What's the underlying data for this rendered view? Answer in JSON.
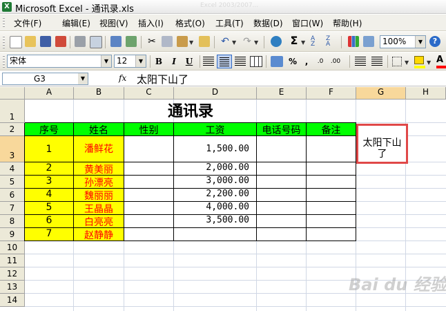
{
  "window": {
    "title": "Microsoft Excel - 通讯录.xls",
    "app_icon": "excel-icon",
    "ghost_text": "Excel 2003/2007..."
  },
  "menu": [
    "文件(F)",
    "编辑(E)",
    "视图(V)",
    "插入(I)",
    "格式(O)",
    "工具(T)",
    "数据(D)",
    "窗口(W)",
    "帮助(H)"
  ],
  "standard_toolbar": {
    "zoom": "100%"
  },
  "format_toolbar": {
    "font_name": "宋体",
    "font_size": "12",
    "bold": "B",
    "italic": "I",
    "underline": "U",
    "percent": "%",
    "comma": ",",
    "inc_dec": ".0",
    "dec_dec": ".00"
  },
  "formula_bar": {
    "name_box": "G3",
    "fx": "fx",
    "content": "太阳下山了"
  },
  "columns": [
    "A",
    "B",
    "C",
    "D",
    "E",
    "F",
    "G",
    "H"
  ],
  "rows": [
    "1",
    "2",
    "3",
    "4",
    "5",
    "6",
    "7",
    "8",
    "9",
    "10",
    "11",
    "12",
    "13",
    "14"
  ],
  "sheet": {
    "title": "通讯录",
    "headers": [
      "序号",
      "姓名",
      "性别",
      "工资",
      "电话号码",
      "备注"
    ],
    "records": [
      {
        "no": "1",
        "name": "潘鲜花",
        "salary": "1,500.00"
      },
      {
        "no": "2",
        "name": "黄美丽",
        "salary": "2,000.00"
      },
      {
        "no": "3",
        "name": "孙漂亮",
        "salary": "3,000.00"
      },
      {
        "no": "4",
        "name": "魏丽丽",
        "salary": "2,200.00"
      },
      {
        "no": "5",
        "name": "王晶晶",
        "salary": "4,000.00"
      },
      {
        "no": "6",
        "name": "白亮亮",
        "salary": "3,500.00"
      },
      {
        "no": "7",
        "name": "赵静静",
        "salary": ""
      }
    ],
    "g3_text": "太阳下山了"
  },
  "watermark": "Bai du 经验"
}
